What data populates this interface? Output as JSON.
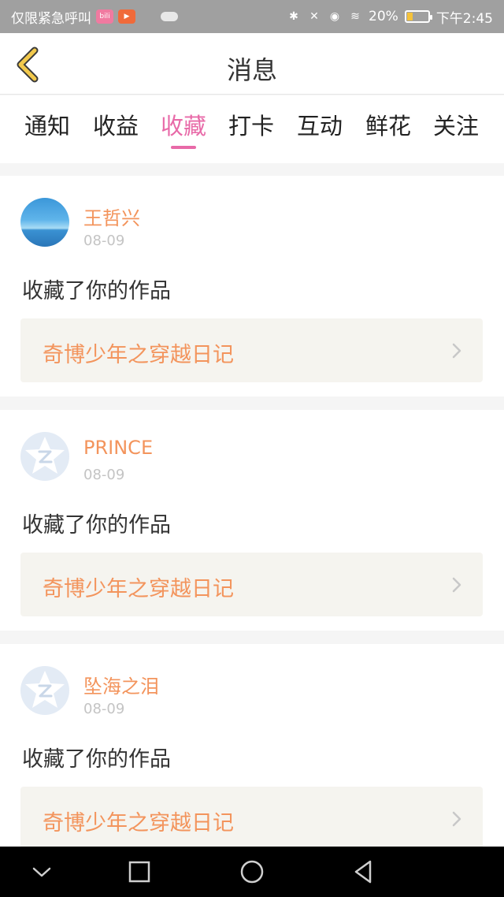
{
  "status_bar": {
    "carrier": "仅限紧急呼叫",
    "battery": "20%",
    "battery_level": 0.2,
    "time": "下午2:45"
  },
  "header": {
    "title": "消息",
    "back_icon": "back-chevron-icon"
  },
  "tabs": [
    {
      "label": "通知",
      "active": false
    },
    {
      "label": "收益",
      "active": false
    },
    {
      "label": "收藏",
      "active": true
    },
    {
      "label": "打卡",
      "active": false
    },
    {
      "label": "互动",
      "active": false
    },
    {
      "label": "鲜花",
      "active": false
    },
    {
      "label": "关注",
      "active": false
    }
  ],
  "messages": [
    {
      "username": "王哲兴",
      "date": "08-09",
      "action": "收藏了你的作品",
      "work_title": "奇博少年之穿越日记",
      "avatar": "sea-photo"
    },
    {
      "username": "PRINCE",
      "date": "08-09",
      "action": "收藏了你的作品",
      "work_title": "奇博少年之穿越日记",
      "avatar": "default-avatar-icon"
    },
    {
      "username": "坠海之泪",
      "date": "08-09",
      "action": "收藏了你的作品",
      "work_title": "奇博少年之穿越日记",
      "avatar": "default-avatar-icon"
    }
  ],
  "colors": {
    "accent_pink": "#e86aa8",
    "name_orange": "#f3945c",
    "back_yellow": "#f2c94c"
  }
}
